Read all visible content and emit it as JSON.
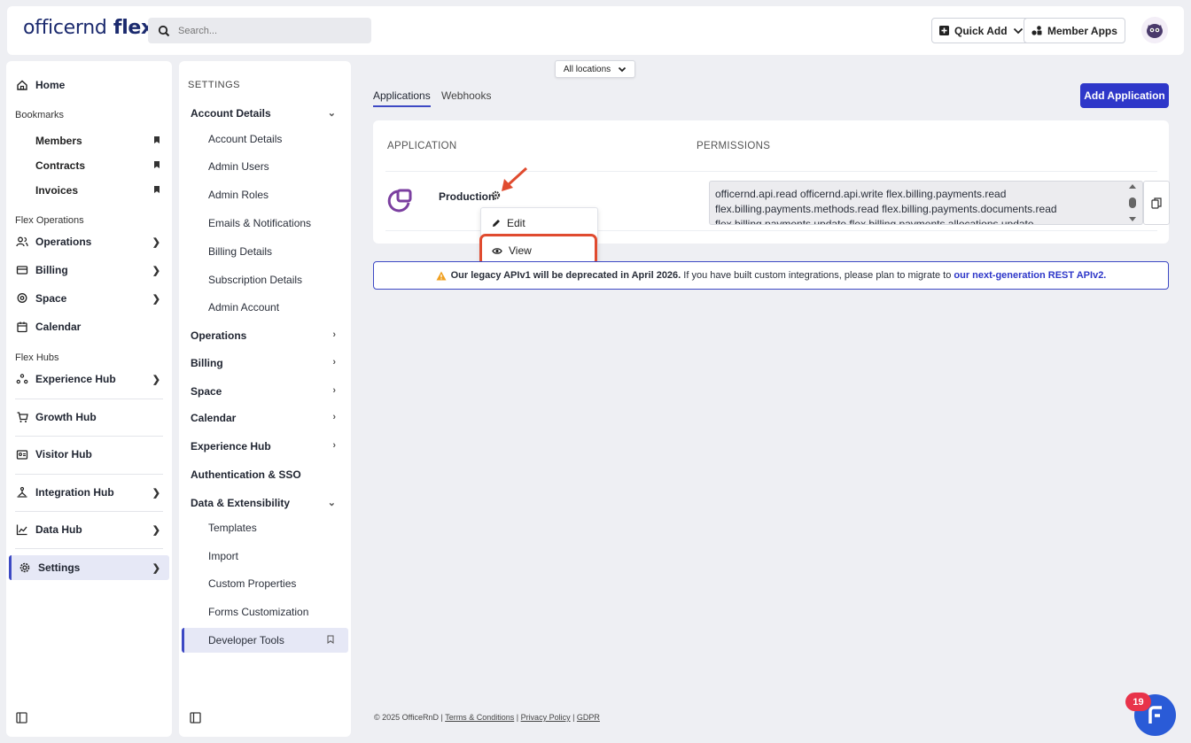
{
  "brand": {
    "logo_light": "officernd",
    "logo_bold": " flex"
  },
  "search": {
    "placeholder": "Search..."
  },
  "header": {
    "quick_add": "Quick Add",
    "member_apps": "Member Apps"
  },
  "leftnav": {
    "home": "Home",
    "bookmarks_title": "Bookmarks",
    "bookmarks": [
      "Members",
      "Contracts",
      "Invoices"
    ],
    "flex_ops_title": "Flex Operations",
    "operations": "Operations",
    "billing": "Billing",
    "space": "Space",
    "calendar": "Calendar",
    "flex_hubs_title": "Flex Hubs",
    "experience_hub": "Experience Hub",
    "growth_hub": "Growth Hub",
    "visitor_hub": "Visitor Hub",
    "integration_hub": "Integration Hub",
    "data_hub": "Data Hub",
    "settings": "Settings"
  },
  "settingsnav": {
    "heading": "SETTINGS",
    "account_details": "Account Details",
    "account_subs": [
      "Account Details",
      "Admin Users",
      "Admin Roles",
      "Emails & Notifications",
      "Billing Details",
      "Subscription Details",
      "Admin Account"
    ],
    "operations": "Operations",
    "billing": "Billing",
    "space": "Space",
    "calendar": "Calendar",
    "experience_hub": "Experience Hub",
    "auth_sso": "Authentication & SSO",
    "data_ext": "Data & Extensibility",
    "data_subs": [
      "Templates",
      "Import",
      "Custom Properties",
      "Forms Customization",
      "Developer Tools"
    ]
  },
  "main": {
    "location": "All locations",
    "tabs": [
      "Applications",
      "Webhooks"
    ],
    "add_button": "Add Application",
    "col_application": "APPLICATION",
    "col_permissions": "PERMISSIONS",
    "app_name": "Production",
    "permissions_text": "officernd.api.read officernd.api.write flex.billing.payments.read flex.billing.payments.methods.read flex.billing.payments.documents.read flex.billing.payments.update flex.billing.payments.allocations.update",
    "menu": {
      "edit": "Edit",
      "view": "View"
    },
    "notice": {
      "bold": "Our legacy APIv1 will be deprecated in April 2026.",
      "normal": " If you have built custom integrations, please plan to migrate to ",
      "link": "our next-generation REST APIv2."
    },
    "footer": {
      "copy": "© 2025 OfficeRnD | ",
      "terms": "Terms & Conditions",
      "sep1": " | ",
      "privacy": "Privacy Policy",
      "sep2": " | ",
      "gdpr": "GDPR"
    }
  },
  "chat": {
    "badge": "19"
  },
  "colors": {
    "accent": "#2e37c9",
    "highlight": "#e04b2f",
    "badge": "#e8334a",
    "brand_purple": "#7b3fa0"
  }
}
